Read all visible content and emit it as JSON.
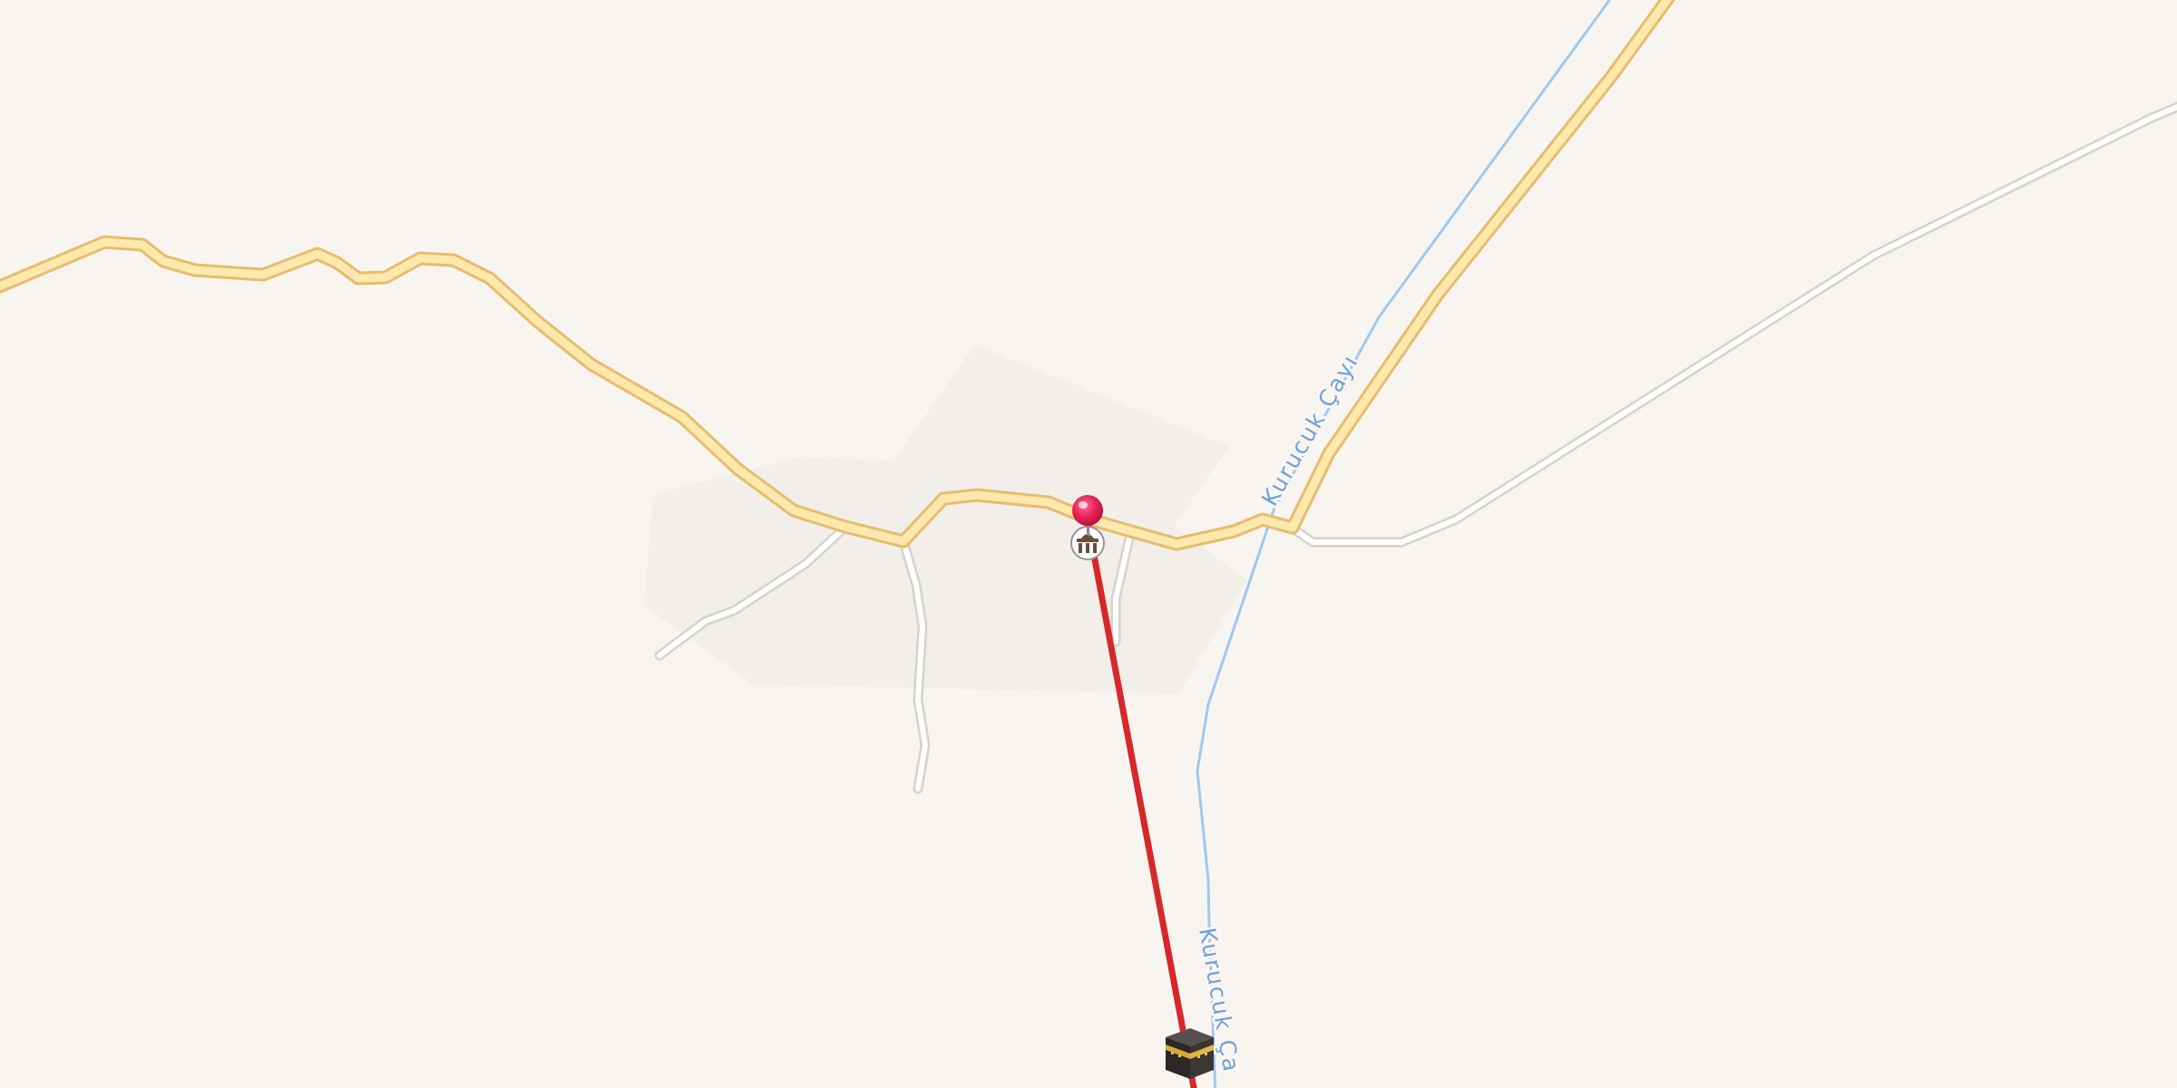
{
  "map": {
    "labels": {
      "river_upper": "Kurucuk Çayı",
      "river_lower": "Kurucuk Ça"
    },
    "colors": {
      "background": "#f8f5f1",
      "settlement_area": "#f2eeea",
      "main_road_fill": "#fde9ae",
      "main_road_casing": "#e6bd6e",
      "minor_road_fill": "#ffffff",
      "minor_road_casing": "#d6d3cf",
      "river": "#9fc8ef",
      "route_line": "#d6282c",
      "pin": "#e8245a"
    },
    "markers": [
      {
        "type": "location-pin",
        "icon": "pin-icon"
      },
      {
        "type": "mosque",
        "icon": "mosque-icon"
      },
      {
        "type": "qibla-kaaba",
        "icon": "kaaba-icon"
      }
    ],
    "route": {
      "type": "qibla-direction-line"
    }
  }
}
